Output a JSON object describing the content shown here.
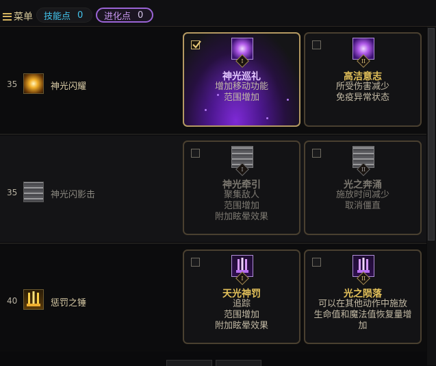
{
  "header": {
    "menu_label": "菜单",
    "skill_points_label": "技能点",
    "skill_points_value": "0",
    "evolution_points_label": "进化点",
    "evolution_points_value": "0"
  },
  "rows": [
    {
      "level": "35",
      "skill_name": "神光闪耀",
      "icon": "radiant-burst-icon",
      "options": [
        {
          "checked": true,
          "roman": "I",
          "title": "神光巡礼",
          "desc": [
            "增加移动功能",
            "范围增加"
          ]
        },
        {
          "checked": false,
          "roman": "II",
          "title": "高洁意志",
          "desc": [
            "所受伤害减少",
            "免疫异常状态"
          ]
        }
      ]
    },
    {
      "level": "35",
      "skill_name": "神光闪影击",
      "icon": "shadow-strike-icon",
      "options": [
        {
          "checked": false,
          "roman": "I",
          "title": "神光牵引",
          "desc": [
            "聚集敌人",
            "范围增加",
            "附加眩晕效果"
          ]
        },
        {
          "checked": false,
          "roman": "II",
          "title": "光之奔涌",
          "desc": [
            "施放时间减少",
            "取消僵直"
          ]
        }
      ]
    },
    {
      "level": "40",
      "skill_name": "惩罚之锤",
      "icon": "hammer-of-punishment-icon",
      "options": [
        {
          "checked": false,
          "roman": "I",
          "title": "天光神罚",
          "desc": [
            "追踪",
            "范围增加",
            "附加眩晕效果"
          ]
        },
        {
          "checked": false,
          "roman": "II",
          "title": "光之陨落",
          "desc": [
            "可以在其他动作中施放",
            "生命值和魔法值恢复量增",
            "加"
          ]
        }
      ]
    }
  ],
  "colors": {
    "accent_gold": "#e3c15a",
    "accent_purple": "#9b64d6",
    "skill_point_blue": "#43c6ef"
  }
}
